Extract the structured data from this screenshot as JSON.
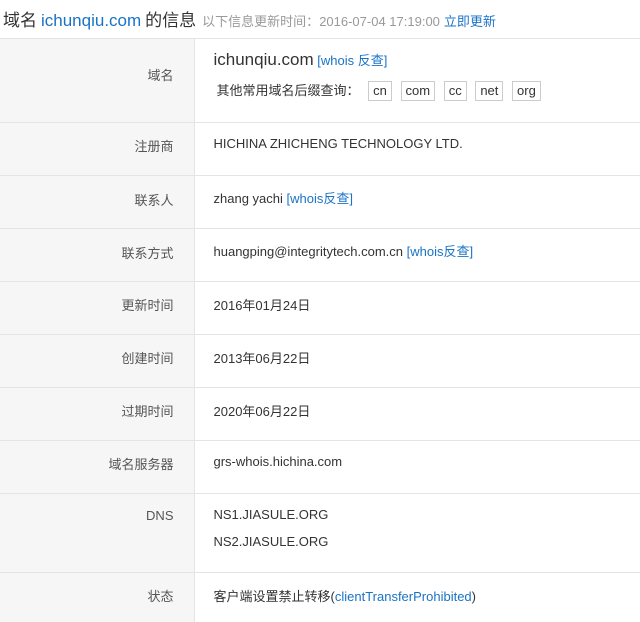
{
  "header": {
    "prefix": "域名",
    "domain": "ichunqiu.com",
    "suffix": "的信息",
    "update_label": "以下信息更新时间：",
    "update_time": "2016-07-04 17:19:00",
    "refresh_link": "立即更新"
  },
  "rows": {
    "domain": {
      "label": "域名",
      "value": "ichunqiu.com",
      "whois_link": "[whois 反查]",
      "suffix_label": "其他常用域名后缀查询：",
      "suffixes": [
        "cn",
        "com",
        "cc",
        "net",
        "org"
      ]
    },
    "registrar": {
      "label": "注册商",
      "value": "HICHINA ZHICHENG TECHNOLOGY LTD."
    },
    "contact": {
      "label": "联系人",
      "value": "zhang yachi",
      "whois_link": "[whois反查]"
    },
    "contact_method": {
      "label": "联系方式",
      "value": "huangping@integritytech.com.cn",
      "whois_link": "[whois反查]"
    },
    "updated": {
      "label": "更新时间",
      "value": "2016年01月24日"
    },
    "created": {
      "label": "创建时间",
      "value": "2013年06月22日"
    },
    "expires": {
      "label": "过期时间",
      "value": "2020年06月22日"
    },
    "whois_server": {
      "label": "域名服务器",
      "value": "grs-whois.hichina.com"
    },
    "dns": {
      "label": "DNS",
      "values": [
        "NS1.JIASULE.ORG",
        "NS2.JIASULE.ORG"
      ]
    },
    "status": {
      "label": "状态",
      "value": "客户端设置禁止转移(",
      "status_link": "clientTransferProhibited",
      "value_end": ")"
    }
  }
}
